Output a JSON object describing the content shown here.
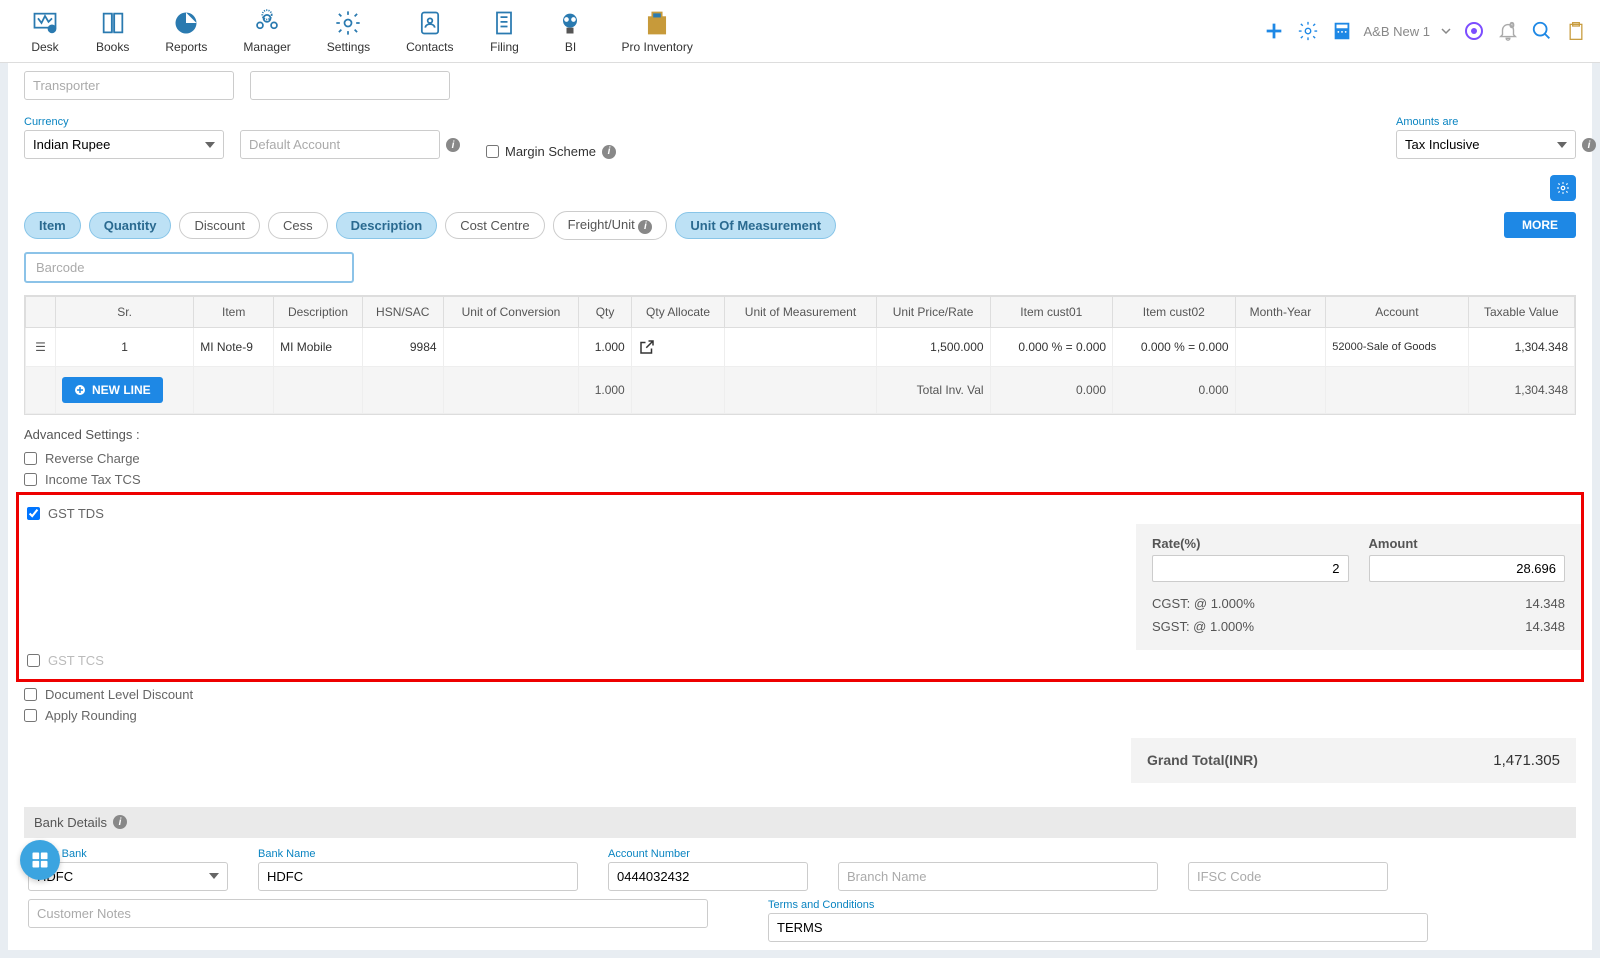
{
  "nav": {
    "items": [
      "Desk",
      "Books",
      "Reports",
      "Manager",
      "Settings",
      "Contacts",
      "Filing",
      "BI",
      "Pro Inventory"
    ],
    "company": "A&B New 1"
  },
  "form": {
    "transporter_placeholder": "Transporter",
    "currency_label": "Currency",
    "currency_value": "Indian Rupee",
    "default_account_placeholder": "Default Account",
    "margin_scheme": "Margin Scheme",
    "amounts_label": "Amounts are",
    "amounts_value": "Tax Inclusive"
  },
  "pills": [
    "Item",
    "Quantity",
    "Discount",
    "Cess",
    "Description",
    "Cost Centre",
    "Freight/Unit",
    "Unit Of Measurement"
  ],
  "more_btn": "MORE",
  "barcode_placeholder": "Barcode",
  "table": {
    "headers": [
      "Sr.",
      "Item",
      "Description",
      "HSN/SAC",
      "Unit of Conversion",
      "Qty",
      "Qty Allocate",
      "Unit of Measurement",
      "Unit Price/Rate",
      "Item cust01",
      "Item cust02",
      "Month-Year",
      "Account",
      "Taxable Value"
    ],
    "row": {
      "sr": "1",
      "item": "MI Note-9",
      "desc": "MI Mobile",
      "hsn": "9984",
      "qty": "1.000",
      "price": "1,500.000",
      "cust01": "0.000 % = 0.000",
      "cust02": "0.000 % = 0.000",
      "account": "52000-Sale of Goods",
      "taxable": "1,304.348"
    },
    "totals": {
      "qty": "1.000",
      "label": "Total Inv. Val",
      "c01": "0.000",
      "c02": "0.000",
      "taxable": "1,304.348"
    },
    "new_line": "NEW LINE"
  },
  "advanced": {
    "title": "Advanced Settings :",
    "reverse": "Reverse Charge",
    "income_tcs": "Income Tax TCS",
    "gst_tds": "GST TDS",
    "gst_tcs": "GST TCS",
    "doc_discount": "Document Level Discount",
    "rounding": "Apply Rounding"
  },
  "tds": {
    "rate_label": "Rate(%)",
    "rate_value": "2",
    "amount_label": "Amount",
    "amount_value": "28.696",
    "cgst_label": "CGST: @ 1.000%",
    "cgst_val": "14.348",
    "sgst_label": "SGST: @ 1.000%",
    "sgst_val": "14.348"
  },
  "grand": {
    "label": "Grand Total(INR)",
    "value": "1,471.305"
  },
  "bank": {
    "header": "Bank Details",
    "select_label": "Select Bank",
    "select_val": "HDFC",
    "name_label": "Bank Name",
    "name_val": "HDFC",
    "acct_label": "Account Number",
    "acct_val": "0444032432",
    "branch_placeholder": "Branch Name",
    "ifsc_placeholder": "IFSC Code"
  },
  "notes": {
    "customer_placeholder": "Customer Notes",
    "terms_label": "Terms and Conditions",
    "terms_val": "TERMS"
  }
}
